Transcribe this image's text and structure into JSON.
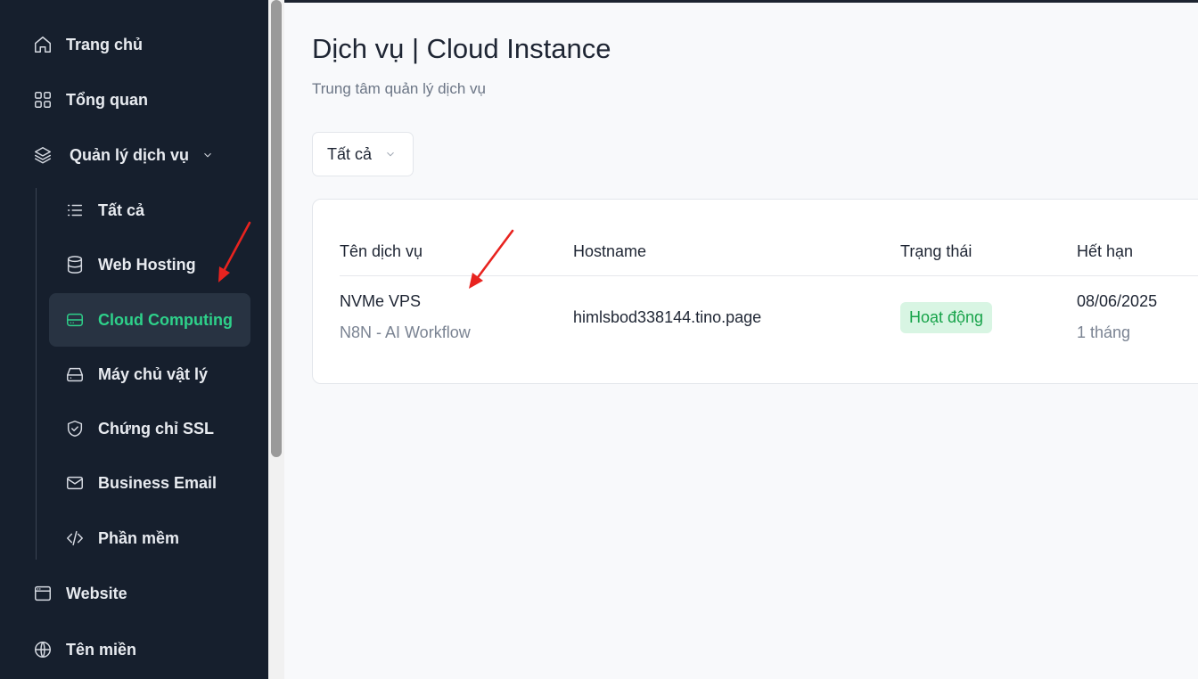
{
  "sidebar": {
    "items": [
      {
        "label": "Trang chủ",
        "icon": "home-icon"
      },
      {
        "label": "Tổng quan",
        "icon": "grid-icon"
      },
      {
        "label": "Quản lý dịch vụ",
        "icon": "layers-icon"
      },
      {
        "label": "Website",
        "icon": "browser-icon"
      },
      {
        "label": "Tên miền",
        "icon": "globe-icon"
      }
    ],
    "sub_items": [
      {
        "label": "Tất cả",
        "icon": "list-icon"
      },
      {
        "label": "Web Hosting",
        "icon": "database-icon"
      },
      {
        "label": "Cloud Computing",
        "icon": "server-icon",
        "active": true
      },
      {
        "label": "Máy chủ vật lý",
        "icon": "hard-drive-icon"
      },
      {
        "label": "Chứng chỉ SSL",
        "icon": "shield-check-icon"
      },
      {
        "label": "Business Email",
        "icon": "mail-icon"
      },
      {
        "label": "Phần mềm",
        "icon": "code-icon"
      }
    ]
  },
  "header": {
    "title": "Dịch vụ | Cloud Instance",
    "subtitle": "Trung tâm quản lý dịch vụ"
  },
  "filter": {
    "selected": "Tất cả"
  },
  "table": {
    "columns": [
      "Tên dịch vụ",
      "Hostname",
      "Trạng thái",
      "Hết hạn"
    ],
    "rows": [
      {
        "service_name": "NVMe VPS",
        "service_plan": "N8N - AI Workflow",
        "hostname": "himlsbod338144.tino.page",
        "status": "Hoạt động",
        "expiry_date": "08/06/2025",
        "billing_cycle": "1 tháng"
      }
    ]
  },
  "colors": {
    "sidebar_bg": "#161f2d",
    "active_accent": "#2ed18a",
    "status_bg": "#d8f5e3",
    "status_text": "#17a34a",
    "annotation_arrow": "#e8231f"
  }
}
